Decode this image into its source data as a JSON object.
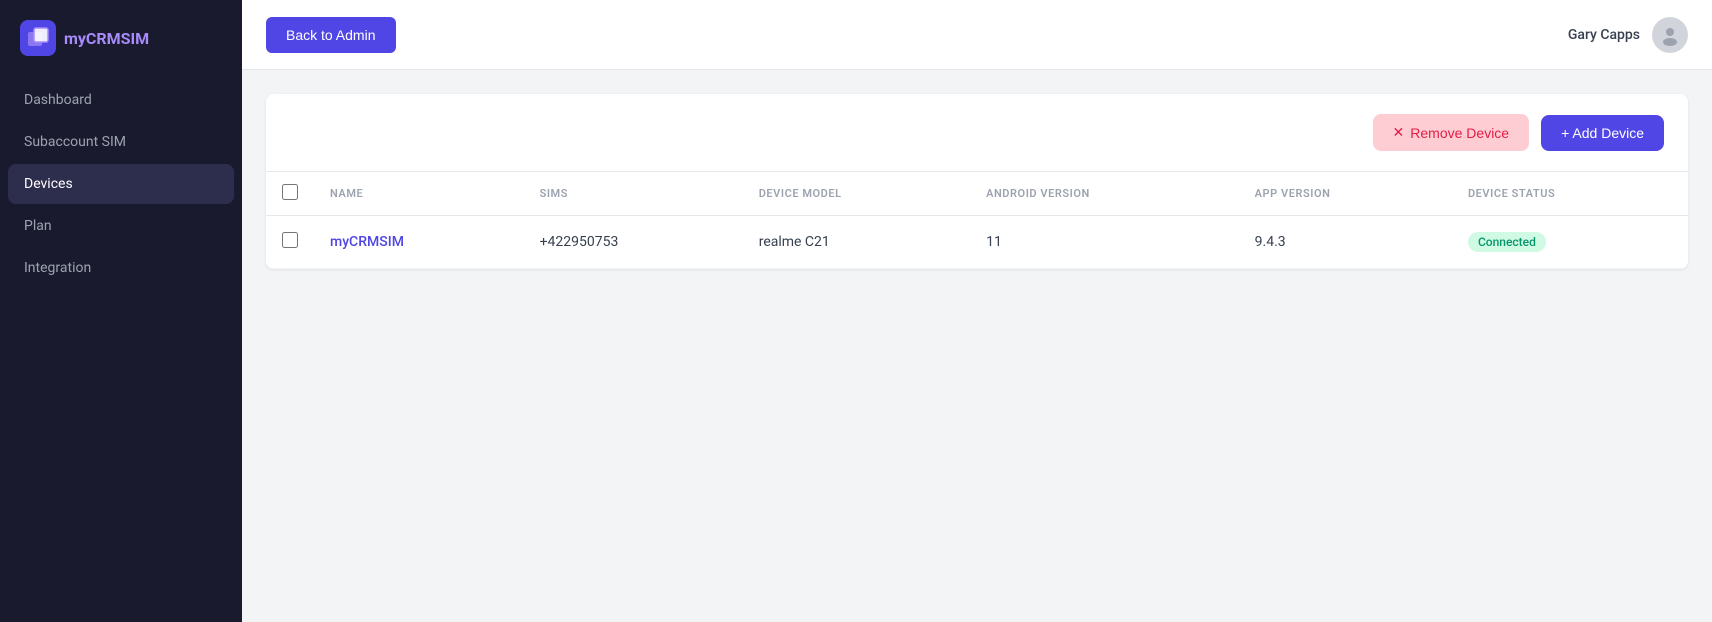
{
  "sidebar": {
    "logo_text_main": "my",
    "logo_text_brand": "CRMSIM",
    "nav_items": [
      {
        "id": "dashboard",
        "label": "Dashboard",
        "active": false
      },
      {
        "id": "subaccount-sim",
        "label": "Subaccount SIM",
        "active": false
      },
      {
        "id": "devices",
        "label": "Devices",
        "active": true
      },
      {
        "id": "plan",
        "label": "Plan",
        "active": false
      },
      {
        "id": "integration",
        "label": "Integration",
        "active": false
      }
    ]
  },
  "header": {
    "back_button_label": "Back to Admin",
    "user_name": "Gary Capps"
  },
  "toolbar": {
    "remove_device_label": "Remove Device",
    "add_device_label": "+ Add Device"
  },
  "table": {
    "columns": [
      {
        "id": "checkbox",
        "label": ""
      },
      {
        "id": "name",
        "label": "NAME"
      },
      {
        "id": "sims",
        "label": "SIMS"
      },
      {
        "id": "device_model",
        "label": "DEVICE MODEL"
      },
      {
        "id": "android_version",
        "label": "ANDROID VERSION"
      },
      {
        "id": "app_version",
        "label": "APP VERSION"
      },
      {
        "id": "device_status",
        "label": "DEVICE STATUS"
      }
    ],
    "rows": [
      {
        "id": "row-1",
        "name": "myCRMSIM",
        "sims": "+422950753",
        "device_model": "realme C21",
        "android_version": "11",
        "app_version": "9.4.3",
        "device_status": "Connected"
      }
    ]
  },
  "colors": {
    "primary": "#4f46e5",
    "sidebar_bg": "#1a1a2e",
    "active_nav_bg": "#2d2d4e",
    "connected_bg": "#d1fae5",
    "connected_text": "#059669",
    "remove_bg": "#fecdd3",
    "remove_text": "#e11d48"
  }
}
